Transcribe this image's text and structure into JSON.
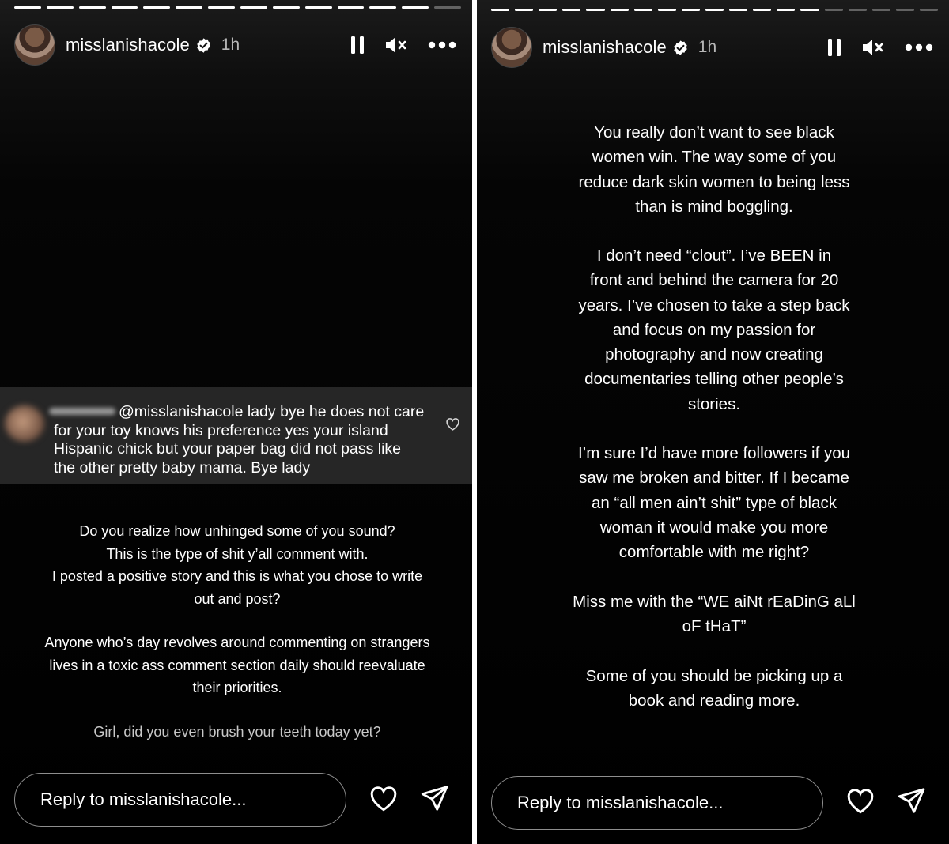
{
  "story": {
    "username": "misslanishacole",
    "time": "1h"
  },
  "left": {
    "progress": {
      "segments": 14,
      "completed": 13
    },
    "comment": {
      "mention": "@misslanishacole",
      "text": "lady bye he does not care for your toy knows his preference yes your island Hispanic chick but your paper bag did not pass like the other pretty baby mama. Bye lady"
    },
    "caption": {
      "p1_line1": "Do you realize how unhinged some of  you sound?",
      "p1_line2": "This is the type of shit y’all comment with.",
      "p1_line3": "I posted a positive story and this is what you chose to write",
      "p1_line4": "out and post?",
      "p2_line1": "Anyone who’s day revolves around commenting on strangers",
      "p2_line2": "lives  in a toxic ass comment section daily  should reevaluate",
      "p2_line3": "their priorities.",
      "p3_line1": "Girl, did you even brush your teeth today yet?"
    }
  },
  "right": {
    "progress": {
      "segments": 19,
      "completed": 14
    },
    "caption": {
      "p1_line1": "You really don’t want to see black",
      "p1_line2": "women win. The way some of you",
      "p1_line3": "reduce dark skin women to being less",
      "p1_line4": "than is mind boggling.",
      "p2_line1": "I don’t need “clout”. I’ve BEEN in",
      "p2_line2": "front and behind the camera for 20",
      "p2_line3": "years. I’ve chosen to take a step back",
      "p2_line4": "and focus on my passion for",
      "p2_line5": "photography and now creating",
      "p2_line6": "documentaries telling other people’s",
      "p2_line7": "stories.",
      "p3_line1": "I’m sure I’d have more followers if you",
      "p3_line2": "saw me broken and bitter. If I became",
      "p3_line3": "an “all men ain’t shit” type of black",
      "p3_line4": "woman it would make you more",
      "p3_line5": "comfortable with me right?",
      "p4_line1": "Miss me with the “WE aiNt rEaDinG aLl",
      "p4_line2": "oF tHaT”",
      "p5_line1": "Some of you should be picking up a",
      "p5_line2": "book and reading more."
    }
  },
  "reply": {
    "placeholder": "Reply to misslanishacole..."
  },
  "icons": {
    "verified": "verified-badge-icon",
    "pause": "pause-icon",
    "mute": "speaker-muted-icon",
    "more": "more-options-icon",
    "like": "heart-icon",
    "share": "paper-plane-icon"
  },
  "colors": {
    "background": "#000000",
    "comment_box": "#262626",
    "text": "#ffffff",
    "reply_border": "#8e8e8e"
  }
}
